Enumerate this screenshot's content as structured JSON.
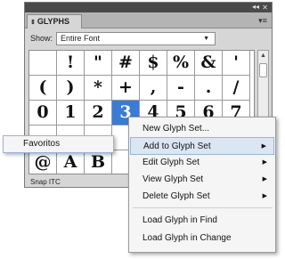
{
  "panel": {
    "tab_label": "GLYPHS",
    "show_label": "Show:",
    "show_value": "Entire Font",
    "font_name": "Snap ITC"
  },
  "glyphs": [
    [
      "",
      "!",
      "\"",
      "#",
      "$",
      "%",
      "&",
      "'"
    ],
    [
      "(",
      ")",
      "*",
      "+",
      ",",
      "-",
      ".",
      "/"
    ],
    [
      "0",
      "1",
      "2",
      "3",
      "4",
      "5",
      "6",
      "7"
    ],
    [
      "",
      "",
      "",
      "",
      "",
      "",
      "",
      ""
    ],
    [
      "@",
      "A",
      "B",
      "",
      "",
      "",
      "",
      ""
    ]
  ],
  "context_menu": {
    "items": [
      {
        "label": "New Glyph Set...",
        "submenu": false
      },
      {
        "label": "Add to Glyph Set",
        "submenu": true
      },
      {
        "label": "Edit Glyph Set",
        "submenu": true
      },
      {
        "label": "View Glyph Set",
        "submenu": true
      },
      {
        "label": "Delete Glyph Set",
        "submenu": true
      },
      {
        "label": "Load Glyph in Find",
        "submenu": false
      },
      {
        "label": "Load Glyph in Change",
        "submenu": false
      }
    ]
  },
  "submenu": {
    "items": [
      "Favoritos"
    ]
  },
  "colors": {
    "selection": "#3a7bd5",
    "menu_highlight": "#dbe6f3"
  }
}
